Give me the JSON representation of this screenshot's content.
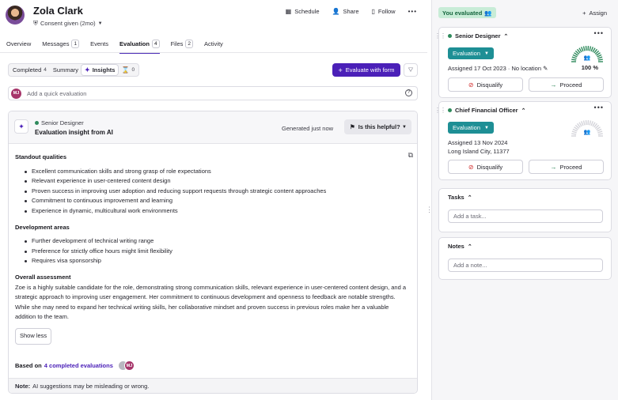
{
  "header": {
    "name": "Zola Clark",
    "consent": "Consent given (2mo)",
    "actions": {
      "schedule": "Schedule",
      "share": "Share",
      "follow": "Follow"
    }
  },
  "tabs": [
    {
      "label": "Overview"
    },
    {
      "label": "Messages",
      "count": "1"
    },
    {
      "label": "Events"
    },
    {
      "label": "Evaluation",
      "count": "4"
    },
    {
      "label": "Files",
      "count": "2"
    },
    {
      "label": "Activity"
    }
  ],
  "subtabs": {
    "completed": "Completed",
    "completed_count": "4",
    "summary": "Summary",
    "insights": "Insights",
    "pending_count": "0"
  },
  "toolbar": {
    "evaluate_label": "Evaluate with form"
  },
  "quick_eval": {
    "initials": "MJ",
    "placeholder": "Add a quick evaluation"
  },
  "insight": {
    "role": "Senior Designer",
    "title": "Evaluation insight from AI",
    "generated": "Generated just now",
    "helpful": "Is this helpful?",
    "standout_heading": "Standout qualities",
    "standout": [
      "Excellent communication skills and strong grasp of role expectations",
      "Relevant experience in user-centered content design",
      "Proven success in improving user adoption and reducing support requests through strategic content approaches",
      "Commitment to continuous improvement and learning",
      "Experience in dynamic, multicultural work environments"
    ],
    "development_heading": "Development areas",
    "development": [
      "Further development of technical writing range",
      "Preference for strictly office hours might limit flexibility",
      "Requires visa sponsorship"
    ],
    "overall_heading": "Overall assessment",
    "overall_text": "Zoe is a highly suitable candidate for the role, demonstrating strong communication skills, relevant experience in user-centered content design, and a strategic approach to improving user engagement. Her commitment to continuous development and openness to feedback are notable strengths. While she may need to expand her technical writing skills, her collaborative mindset and proven success in previous roles make her a valuable addition to the team.",
    "show_less": "Show less",
    "based_prefix": "Based on",
    "based_link": "4 completed evaluations",
    "based_initials": "MJ",
    "note_label": "Note:",
    "note_text": "AI suggestions may be misleading or wrong."
  },
  "sidebar": {
    "you_evaluated": "You evaluated",
    "assign": "Assign",
    "jobs": [
      {
        "title": "Senior Designer",
        "stage": "Evaluation",
        "assigned": "Assigned 17 Oct 2023",
        "location": "No location",
        "score": "100 %",
        "score_fraction": 1.0,
        "disqualify": "Disqualify",
        "proceed": "Proceed"
      },
      {
        "title": "Chief Financial Officer",
        "stage": "Evaluation",
        "assigned": "Assigned 13 Nov 2024",
        "location": "Long Island City, 11377",
        "score_fraction": 0,
        "disqualify": "Disqualify",
        "proceed": "Proceed"
      }
    ],
    "tasks": {
      "title": "Tasks",
      "placeholder": "Add a task..."
    },
    "notes": {
      "title": "Notes",
      "placeholder": "Add a note..."
    }
  },
  "colors": {
    "accent": "#4b20b8",
    "stage": "#1e8f95",
    "success": "#2e8a5c",
    "danger": "#d12b2b"
  }
}
